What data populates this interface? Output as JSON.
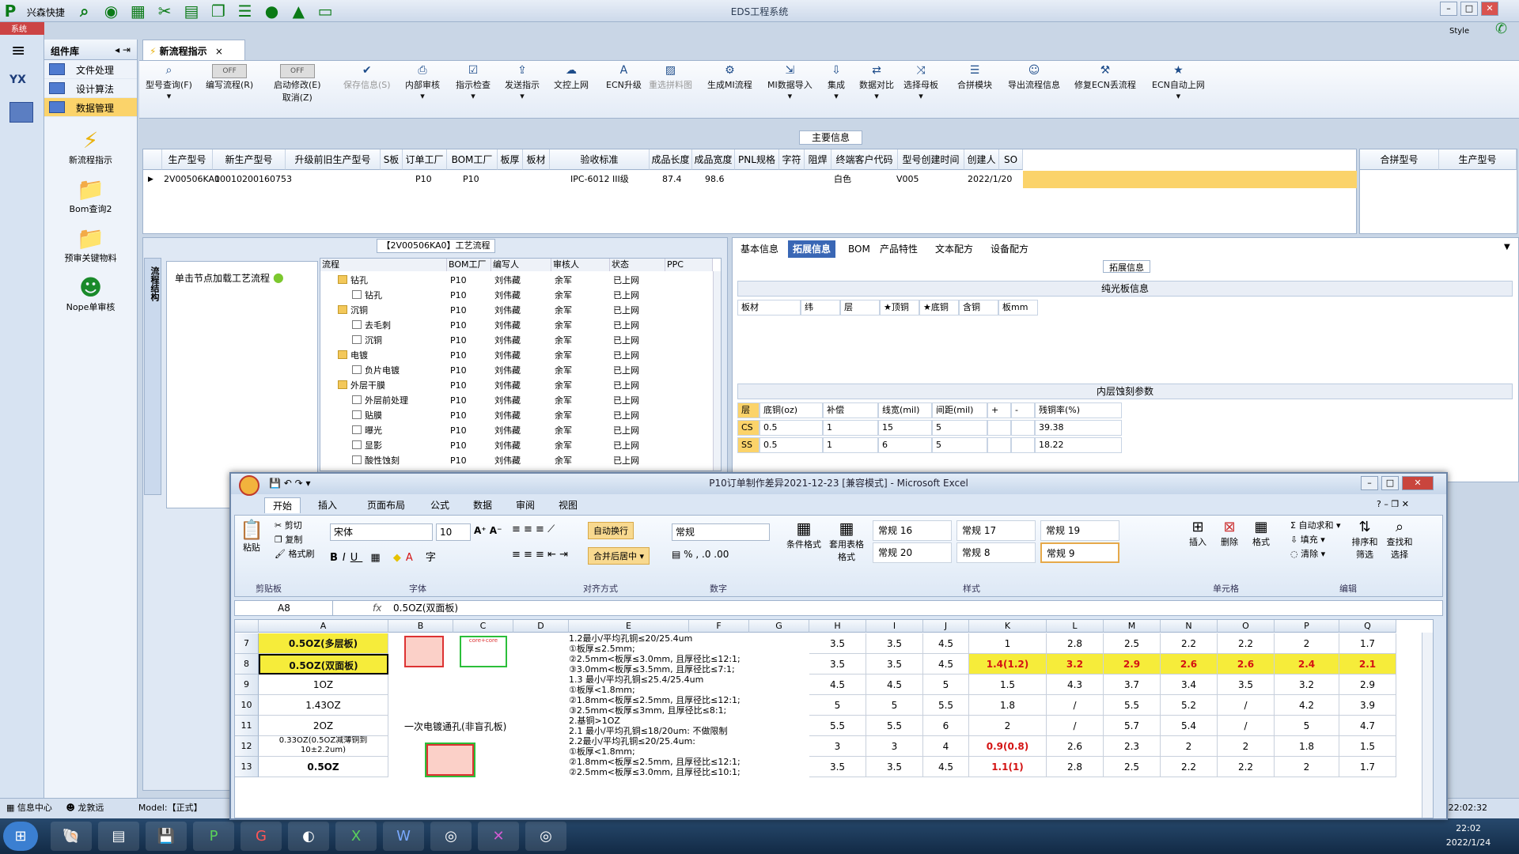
{
  "titlebar": {
    "quick_launch": "兴森快捷",
    "app_title": "EDS工程系统",
    "style_label": "Style"
  },
  "leftnav": {
    "sys_label": "系统"
  },
  "tree_panel": {
    "header": "组件库",
    "items": [
      "文件处理",
      "设计算法",
      "数据管理"
    ],
    "launchers": [
      "新流程指示",
      "Bom查询2",
      "预审关键物料",
      "Nope单审核"
    ]
  },
  "doc_tab": {
    "label": "新流程指示"
  },
  "ribbon": {
    "buttons": [
      "型号查询(F)",
      "编写流程(R)",
      "启动修改(E)",
      "取消(Z)",
      "保存信息(S)",
      "内部审核",
      "指示检查",
      "发送指示",
      "文控上网",
      "ECN升级",
      "重选拼料图",
      "生成MI流程",
      "MI数据导入",
      "集成",
      "数据对比",
      "选择母板",
      "合拼模块",
      "导出流程信息",
      "修复ECN丢流程",
      "ECN自动上网"
    ],
    "toggle_off": "OFF"
  },
  "main_info": {
    "label": "主要信息"
  },
  "grid": {
    "headers": [
      "生产型号",
      "新生产型号",
      "升级前旧生产型号",
      "S板",
      "订单工厂",
      "BOM工厂",
      "板厚",
      "板材",
      "验收标准",
      "成品长度",
      "成品宽度",
      "PNL规格",
      "字符",
      "阻焊",
      "终端客户代码",
      "型号创建时间",
      "创建人",
      "SO"
    ],
    "row": [
      "2V00506KA0",
      "10010200160753",
      "",
      "",
      "P10",
      "P10",
      "",
      "",
      "IPC-6012 III级",
      "87.4",
      "98.6",
      "",
      "",
      "白色",
      "V005",
      "2022/1/20",
      "",
      ""
    ]
  },
  "merge_grid": {
    "headers": [
      "合拼型号",
      "生产型号"
    ]
  },
  "process": {
    "title": "【2V00506KA0】工艺流程",
    "vtab": "流程结构",
    "hint": "单击节点加载工艺流程",
    "headers": [
      "流程",
      "BOM工厂",
      "编写人",
      "审核人",
      "状态",
      "PPC"
    ],
    "rows": [
      {
        "name": "钻孔",
        "folder": true,
        "indent": 1,
        "bom": "P10",
        "writer": "刘伟藏",
        "auditor": "余军",
        "status": "已上网"
      },
      {
        "name": "钻孔",
        "folder": false,
        "indent": 2,
        "bom": "P10",
        "writer": "刘伟藏",
        "auditor": "余军",
        "status": "已上网"
      },
      {
        "name": "沉铜",
        "folder": true,
        "indent": 1,
        "bom": "P10",
        "writer": "刘伟藏",
        "auditor": "余军",
        "status": "已上网"
      },
      {
        "name": "去毛刺",
        "folder": false,
        "indent": 2,
        "bom": "P10",
        "writer": "刘伟藏",
        "auditor": "余军",
        "status": "已上网"
      },
      {
        "name": "沉铜",
        "folder": false,
        "indent": 2,
        "bom": "P10",
        "writer": "刘伟藏",
        "auditor": "余军",
        "status": "已上网"
      },
      {
        "name": "电镀",
        "folder": true,
        "indent": 1,
        "bom": "P10",
        "writer": "刘伟藏",
        "auditor": "余军",
        "status": "已上网"
      },
      {
        "name": "负片电镀",
        "folder": false,
        "indent": 2,
        "bom": "P10",
        "writer": "刘伟藏",
        "auditor": "余军",
        "status": "已上网"
      },
      {
        "name": "外层干膜",
        "folder": true,
        "indent": 1,
        "bom": "P10",
        "writer": "刘伟藏",
        "auditor": "余军",
        "status": "已上网"
      },
      {
        "name": "外层前处理",
        "folder": false,
        "indent": 2,
        "bom": "P10",
        "writer": "刘伟藏",
        "auditor": "余军",
        "status": "已上网"
      },
      {
        "name": "贴膜",
        "folder": false,
        "indent": 2,
        "bom": "P10",
        "writer": "刘伟藏",
        "auditor": "余军",
        "status": "已上网"
      },
      {
        "name": "曝光",
        "folder": false,
        "indent": 2,
        "bom": "P10",
        "writer": "刘伟藏",
        "auditor": "余军",
        "status": "已上网"
      },
      {
        "name": "显影",
        "folder": false,
        "indent": 2,
        "bom": "P10",
        "writer": "刘伟藏",
        "auditor": "余军",
        "status": "已上网"
      },
      {
        "name": "酸性蚀刻",
        "folder": false,
        "indent": 2,
        "bom": "P10",
        "writer": "刘伟藏",
        "auditor": "余军",
        "status": "已上网"
      }
    ]
  },
  "detail": {
    "tabs": [
      "基本信息",
      "拓展信息",
      "BOM",
      "产品特性",
      "文本配方",
      "设备配方"
    ],
    "ext_label": "拓展信息",
    "plain_board": {
      "title": "纯光板信息",
      "headers": [
        "板材",
        "纬",
        "层",
        "★顶铜",
        "★底铜",
        "含铜",
        "板mm"
      ]
    },
    "inner_etch": {
      "title": "内层蚀刻参数",
      "headers": [
        "层",
        "底铜(oz)",
        "补偿",
        "线宽(mil)",
        "间距(mil)",
        "+",
        "-",
        "残铜率(%)"
      ],
      "rows": [
        [
          "CS",
          "0.5",
          "1",
          "15",
          "5",
          "",
          "",
          "39.38"
        ],
        [
          "SS",
          "0.5",
          "1",
          "6",
          "5",
          "",
          "",
          "18.22"
        ]
      ]
    }
  },
  "status_bar": {
    "info_center": "信息中心",
    "user": "龙敦远",
    "model": "Model:【正式】",
    "time": "22:02:32"
  },
  "taskbar": {
    "time": "22:02",
    "date": "2022/1/24"
  },
  "excel": {
    "title": "P10订单制作差异2021-12-23 [兼容模式] - Microsoft Excel",
    "tabs": [
      "开始",
      "插入",
      "页面布局",
      "公式",
      "数据",
      "审阅",
      "视图"
    ],
    "clipboard": {
      "paste": "粘贴",
      "cut": "剪切",
      "copy": "复制",
      "format": "格式刷",
      "group": "剪贴板"
    },
    "font": {
      "name": "宋体",
      "size": "10",
      "group": "字体"
    },
    "align": {
      "wrap": "自动换行",
      "merge": "合并后居中",
      "group": "对齐方式"
    },
    "number": {
      "format": "常规",
      "group": "数字"
    },
    "styles": {
      "cond": "条件格式",
      "table": "套用表格格式",
      "cells": [
        "常规 16",
        "常规 17",
        "常规 19",
        "常规 20",
        "常规 8",
        "常规 9"
      ],
      "group": "样式"
    },
    "cells_group": {
      "insert": "插入",
      "delete": "删除",
      "format": "格式",
      "group": "单元格"
    },
    "edit_group": {
      "autosum": "自动求和",
      "fill": "填充",
      "clear": "清除",
      "sort": "排序和筛选",
      "find": "查找和选择",
      "group": "编辑"
    },
    "namebox": "A8",
    "formula": "0.5OZ(双面板)",
    "columns": [
      "A",
      "B",
      "C",
      "D",
      "E",
      "F",
      "G",
      "H",
      "I",
      "J",
      "K",
      "L",
      "M",
      "N",
      "O",
      "P",
      "Q"
    ],
    "rows": [
      {
        "num": "7",
        "a": "0.5OZ(多层板)",
        "notes": [
          "1.2最小/平均孔铜≤20/25.4um",
          "①板厚≤2.5mm;"
        ],
        "h": "3.5",
        "i": "3.5",
        "j": "4.5",
        "k": "1",
        "l": "2.8",
        "m": "2.5",
        "n": "2.2",
        "o": "2.2",
        "p": "2",
        "q": "1.7"
      },
      {
        "num": "8",
        "a": "0.5OZ(双面板)",
        "notes": [
          "②2.5mm<板厚≤3.0mm, 且厚径比≤12:1;",
          "③3.0mm<板厚≤3.5mm, 且厚径比≤7:1;"
        ],
        "h": "3.5",
        "i": "3.5",
        "j": "4.5",
        "k": "1.4(1.2)",
        "l": "3.2",
        "m": "2.9",
        "n": "2.6",
        "o": "2.6",
        "p": "2.4",
        "q": "2.1"
      },
      {
        "num": "9",
        "a": "1OZ",
        "notes": [
          "1.3 最小/平均孔铜≤25.4/25.4um",
          "①板厚<1.8mm;"
        ],
        "h": "4.5",
        "i": "4.5",
        "j": "5",
        "k": "1.5",
        "l": "4.3",
        "m": "3.7",
        "n": "3.4",
        "o": "3.5",
        "p": "3.2",
        "q": "2.9"
      },
      {
        "num": "10",
        "a": "1.43OZ",
        "notes": [
          "②1.8mm<板厚≤2.5mm, 且厚径比≤12:1;",
          "③2.5mm<板厚≤3mm, 且厚径比≤8:1;"
        ],
        "h": "5",
        "i": "5",
        "j": "5.5",
        "k": "1.8",
        "l": "/",
        "m": "5.5",
        "n": "5.2",
        "o": "/",
        "p": "4.2",
        "q": "3.9"
      },
      {
        "num": "11",
        "a": "2OZ",
        "notes": [
          "2.基铜>1OZ",
          "2.1 最小/平均孔铜≤18/20um: 不做限制"
        ],
        "h": "5.5",
        "i": "5.5",
        "j": "6",
        "k": "2",
        "l": "/",
        "m": "5.7",
        "n": "5.4",
        "o": "/",
        "p": "5",
        "q": "4.7"
      },
      {
        "num": "12",
        "a": "0.33OZ(0.5OZ减薄铜到10±2.2um)",
        "notes": [
          "2.2最小/平均孔铜≤20/25.4um:",
          "①板厚<1.8mm;"
        ],
        "h": "3",
        "i": "3",
        "j": "4",
        "k": "0.9(0.8)",
        "l": "2.6",
        "m": "2.3",
        "n": "2",
        "o": "2",
        "p": "1.8",
        "q": "1.5"
      },
      {
        "num": "13",
        "a": "0.5OZ",
        "notes": [
          "②1.8mm<板厚≤2.5mm, 且厚径比≤12:1;",
          "②2.5mm<板厚≤3.0mm, 且厚径比≤10:1;"
        ],
        "h": "3.5",
        "i": "3.5",
        "j": "4.5",
        "k": "1.1(1)",
        "l": "2.8",
        "m": "2.5",
        "n": "2.2",
        "o": "2.2",
        "p": "2",
        "q": "1.7"
      }
    ],
    "merged_b": "一次电镀通孔(非盲孔板)",
    "core_label": "core+core"
  }
}
